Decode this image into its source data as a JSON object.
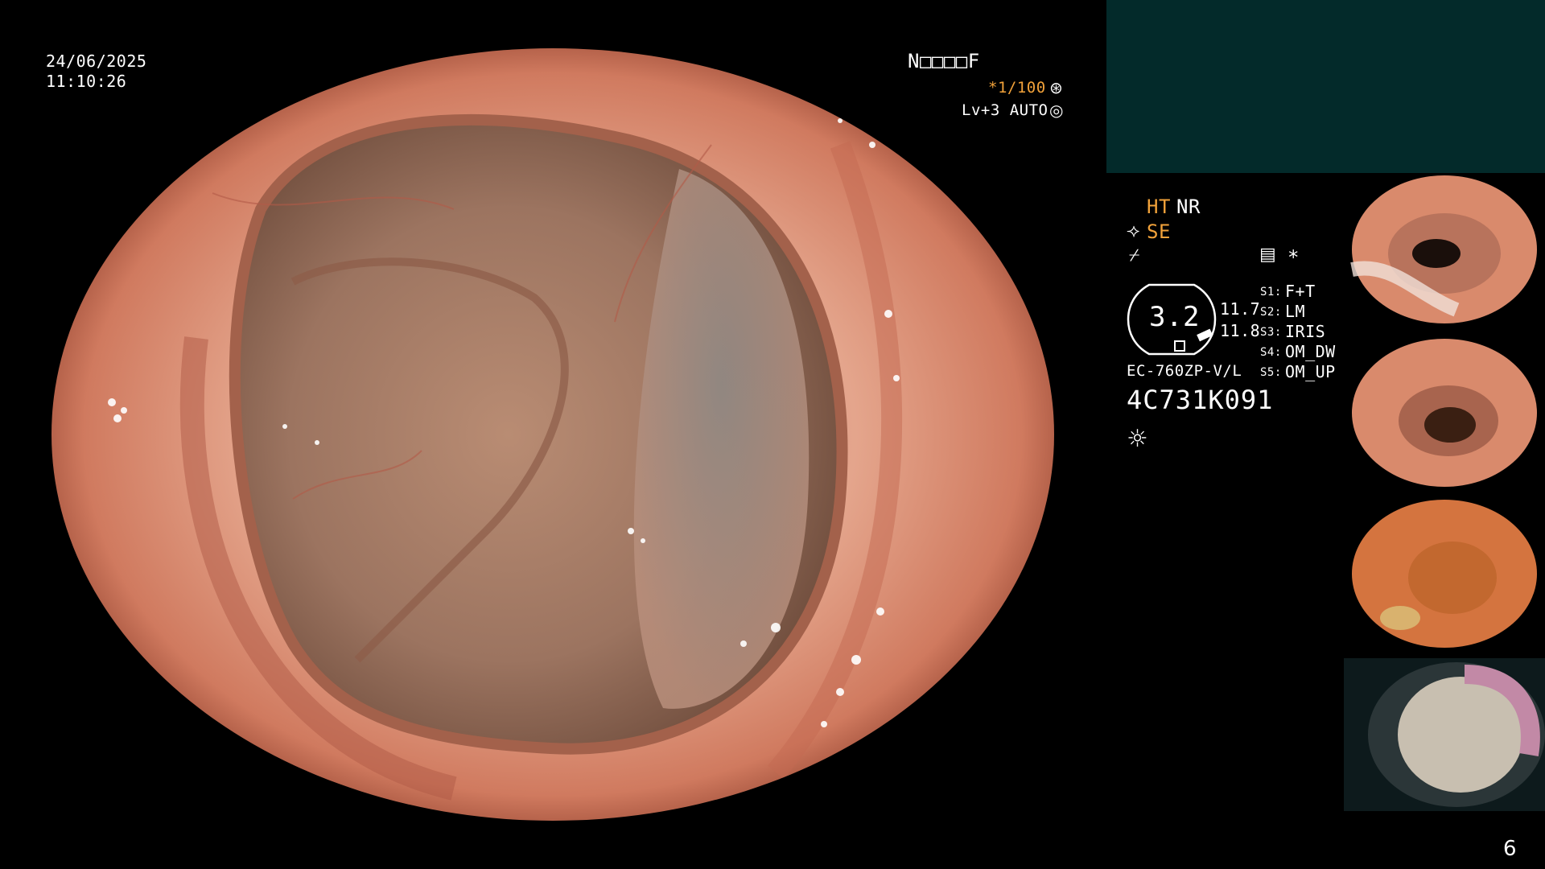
{
  "overlay": {
    "date": "24/06/2025",
    "time": "11:10:26",
    "patient_id": "N□□□□F",
    "shutter": "*1/100",
    "shutter_icon": "⊛",
    "level": "Lv+3 AUTO",
    "level_icon": "◎"
  },
  "modes": {
    "ht": "HT",
    "nr": "NR",
    "se": "SE",
    "se_icon": "⟢",
    "freeze_icon": "⌿",
    "memo_icon": "▤",
    "star_icon": "*"
  },
  "scope": {
    "gauge_value": "3.2",
    "upper_value": "11.7",
    "lower_value": "11.8",
    "model": "EC-760ZP-V/L",
    "serial": "4C731K091",
    "light_icon": "☼"
  },
  "switches": [
    {
      "label": "S1:",
      "value": "F+T"
    },
    {
      "label": "S2:",
      "value": "LM"
    },
    {
      "label": "S3:",
      "value": "IRIS"
    },
    {
      "label": "S4:",
      "value": "OM_DW"
    },
    {
      "label": "S5:",
      "value": "OM_UP"
    }
  ],
  "page": {
    "number": "6"
  },
  "colors": {
    "accent": "#f2a23a",
    "panel": "#032a2a",
    "mucosa": "#d98a6c"
  }
}
